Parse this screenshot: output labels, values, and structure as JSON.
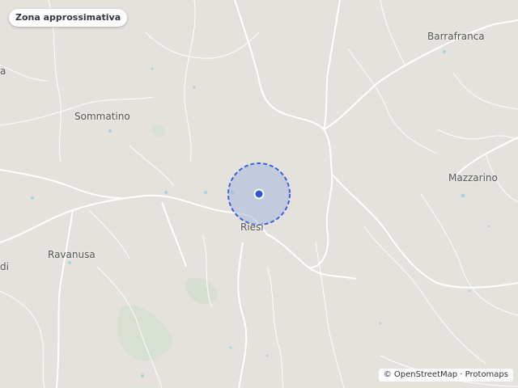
{
  "map": {
    "area_label": "Zona approssimativa",
    "towns": {
      "barrafranca": "Barrafranca",
      "sommatino": "Sommatino",
      "mazzarino": "Mazzarino",
      "riesi": "Riesi",
      "ravanusa": "Ravanusa",
      "partial_left_a": "a",
      "partial_left_di": "di"
    },
    "attribution": {
      "copyright": "© OpenStreetMap",
      "separator": " · ",
      "provider": "Protomaps"
    },
    "colors": {
      "land": "#e5e2de",
      "road": "#ffffff",
      "water": "#a9d3de",
      "vegetation": "#d3ddd0",
      "accuracy_fill": "#a9b7df",
      "accuracy_stroke": "#3d63d8",
      "location_dot": "#2f57d6"
    }
  }
}
